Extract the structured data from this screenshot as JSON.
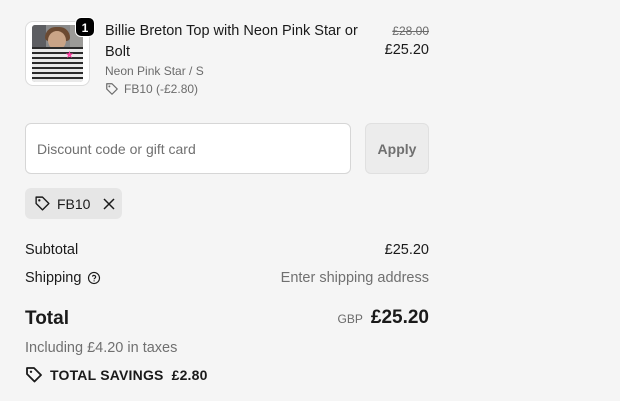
{
  "line_item": {
    "quantity": "1",
    "title": "Billie Breton Top with Neon Pink Star or Bolt",
    "variant": "Neon Pink Star / S",
    "discount": "FB10 (-£2.80)",
    "original_price": "£28.00",
    "price": "£25.20",
    "thumbnail_icon": "product-image"
  },
  "discount_form": {
    "placeholder": "Discount code or gift card",
    "value": "",
    "apply_label": "Apply"
  },
  "applied_code": {
    "code": "FB10",
    "tag_icon": "tag-icon",
    "remove_icon": "close-icon"
  },
  "summary": {
    "subtotal_label": "Subtotal",
    "subtotal_value": "£25.20",
    "shipping_label": "Shipping",
    "shipping_value": "Enter shipping address",
    "total_label": "Total",
    "currency": "GBP",
    "total_value": "£25.20",
    "taxes_note": "Including £4.20 in taxes",
    "savings_label": "TOTAL SAVINGS",
    "savings_value": "£2.80"
  },
  "colors": {
    "background": "#f5f5f5",
    "text": "#1a1a1a",
    "muted": "#707070",
    "chip_bg": "#e6e6e6",
    "badge_bg": "#000000"
  }
}
